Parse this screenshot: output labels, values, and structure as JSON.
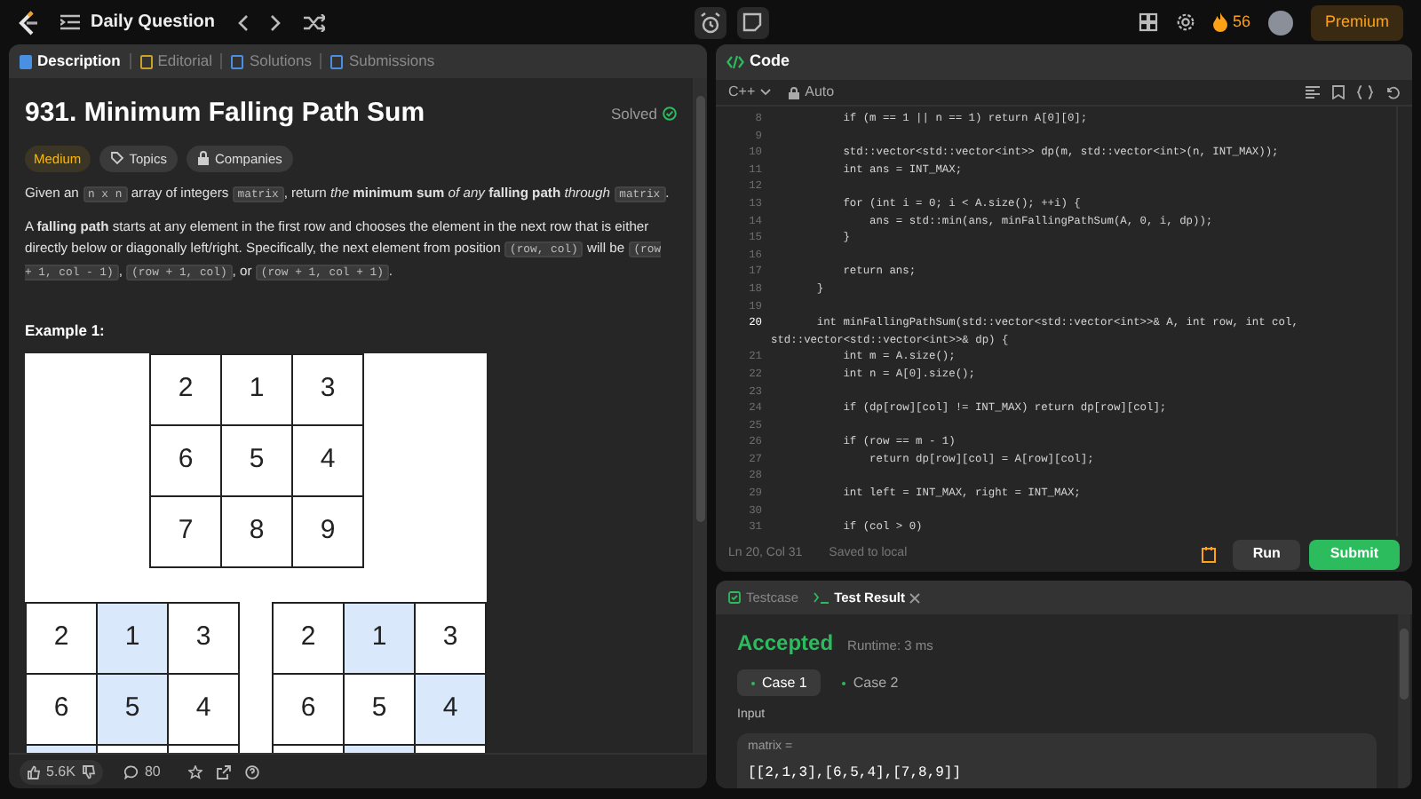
{
  "top_bar": {
    "title": "Daily Question",
    "streak": "56",
    "premium": "Premium"
  },
  "left_tabs": [
    {
      "label": "Description",
      "selected": true
    },
    {
      "label": "Editorial",
      "selected": false
    },
    {
      "label": "Solutions",
      "selected": false
    },
    {
      "label": "Submissions",
      "selected": false
    }
  ],
  "problem": {
    "title": "931. Minimum Falling Path Sum",
    "status": "Solved",
    "difficulty": "Medium",
    "tags": [
      "Topics",
      "Companies"
    ],
    "paragraphs": [
      [
        {
          "kind": "text",
          "text": "Given an "
        },
        {
          "kind": "code",
          "text": "n x n"
        },
        {
          "kind": "text",
          "text": " array of integers "
        },
        {
          "kind": "code",
          "text": "matrix"
        },
        {
          "kind": "text",
          "text": ", return *the* **minimum sum** *of any* **falling path** *through* "
        },
        {
          "kind": "code",
          "text": "matrix"
        },
        {
          "kind": "text",
          "text": "."
        }
      ],
      [
        {
          "kind": "text",
          "text": "A **falling path** starts at any element in the first row and chooses the element in the next row that is either directly below or diagonally left/right. Specifically, the next element from position "
        },
        {
          "kind": "code",
          "text": "(row, col)"
        },
        {
          "kind": "text",
          "text": " will be "
        },
        {
          "kind": "code",
          "text": "(row + 1, col - 1)"
        },
        {
          "kind": "text",
          "text": ", "
        },
        {
          "kind": "code",
          "text": "(row + 1, col)"
        },
        {
          "kind": "text",
          "text": ", or "
        },
        {
          "kind": "code",
          "text": "(row + 1, col + 1)"
        },
        {
          "kind": "text",
          "text": "."
        }
      ]
    ],
    "example_heading": "Example 1:"
  },
  "figure": {
    "matrix": [
      [
        "2",
        "1",
        "3"
      ],
      [
        "6",
        "5",
        "4"
      ],
      [
        "7",
        "8",
        "9"
      ]
    ],
    "paths": [
      {
        "rows": [
          [
            {
              "value": "2",
              "highlighted": false
            },
            {
              "value": "1",
              "highlighted": true
            },
            {
              "value": "3",
              "highlighted": false
            }
          ],
          [
            {
              "value": "6",
              "highlighted": false
            },
            {
              "value": "5",
              "highlighted": true
            },
            {
              "value": "4",
              "highlighted": false
            }
          ],
          [
            {
              "highlighted": true
            },
            {
              "highlighted": false
            },
            {
              "highlighted": false
            }
          ]
        ]
      },
      {
        "rows": [
          [
            {
              "value": "2",
              "highlighted": false
            },
            {
              "value": "1",
              "highlighted": true
            },
            {
              "value": "3",
              "highlighted": false
            }
          ],
          [
            {
              "value": "6",
              "highlighted": false
            },
            {
              "value": "5",
              "highlighted": false
            },
            {
              "value": "4",
              "highlighted": true
            }
          ],
          [
            {
              "highlighted": false
            },
            {
              "highlighted": true
            },
            {
              "highlighted": false
            }
          ]
        ]
      }
    ]
  },
  "footer": {
    "likes": "5.6K",
    "comments": "80"
  },
  "code_panel": {
    "title": "Code",
    "language": "C++",
    "mode": "Auto",
    "lines": [
      {
        "number": "8",
        "text": "        if (m == 1 || n == 1) return A[0][0];",
        "current": false
      },
      {
        "number": "9",
        "current": false
      },
      {
        "number": "10",
        "text": "        std::vector<std::vector<int>> dp(m, std::vector<int>(n, INT_MAX));",
        "current": false
      },
      {
        "number": "11",
        "text": "        int ans = INT_MAX;",
        "current": false
      },
      {
        "number": "12",
        "current": false
      },
      {
        "number": "13",
        "text": "        for (int i = 0; i < A.size(); ++i) {",
        "current": false
      },
      {
        "number": "14",
        "text": "            ans = std::min(ans, minFallingPathSum(A, 0, i, dp));",
        "current": false
      },
      {
        "number": "15",
        "text": "        }",
        "current": false
      },
      {
        "number": "16",
        "current": false
      },
      {
        "number": "17",
        "text": "        return ans;",
        "current": false
      },
      {
        "number": "18",
        "text": "    }",
        "current": false
      },
      {
        "number": "19",
        "current": false
      },
      {
        "number": "20",
        "text": "    int minFallingPathSum(std::vector<std::vector<int>>& A, int row, int col,",
        "continuation": "std::vector<std::vector<int>>& dp) {",
        "current": true
      },
      {
        "number": "21",
        "text": "        int m = A.size();",
        "current": false
      },
      {
        "number": "22",
        "text": "        int n = A[0].size();",
        "current": false
      },
      {
        "number": "23",
        "current": false
      },
      {
        "number": "24",
        "text": "        if (dp[row][col] != INT_MAX) return dp[row][col];",
        "current": false
      },
      {
        "number": "25",
        "current": false
      },
      {
        "number": "26",
        "text": "        if (row == m - 1)",
        "current": false
      },
      {
        "number": "27",
        "text": "            return dp[row][col] = A[row][col];",
        "current": false
      },
      {
        "number": "28",
        "current": false
      },
      {
        "number": "29",
        "text": "        int left = INT_MAX, right = INT_MAX;",
        "current": false
      },
      {
        "number": "30",
        "current": false
      },
      {
        "number": "31",
        "text": "        if (col > 0)",
        "current": false
      }
    ],
    "cursor": "Ln 20, Col 31",
    "save_status": "Saved to local",
    "run": "Run",
    "submit": "Submit"
  },
  "test_panel": {
    "tabs": [
      {
        "label": "Testcase",
        "selected": false
      },
      {
        "label": "Test Result",
        "selected": true
      }
    ],
    "verdict": "Accepted",
    "runtime": "Runtime: 3 ms",
    "cases": [
      {
        "label": "Case 1",
        "selected": true
      },
      {
        "label": "Case 2",
        "selected": false
      }
    ],
    "input_label": "Input",
    "param_name": "matrix =",
    "param_value": "[[2,1,3],[6,5,4],[7,8,9]]"
  }
}
